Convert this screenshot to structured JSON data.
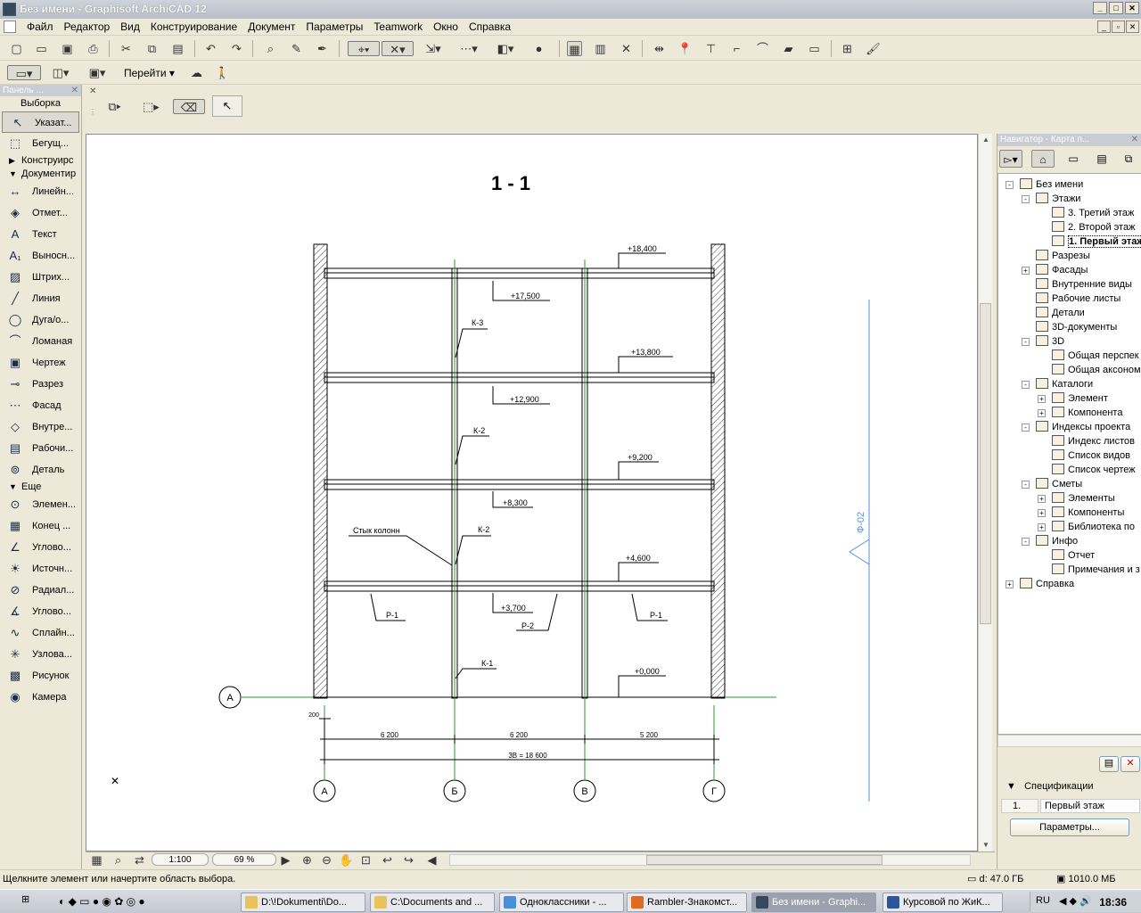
{
  "app": {
    "title": "Без имени - Graphisoft ArchiCAD 12"
  },
  "menu": [
    "Файл",
    "Редактор",
    "Вид",
    "Конструирование",
    "Документ",
    "Параметры",
    "Teamwork",
    "Окно",
    "Справка"
  ],
  "toolbar2": {
    "goto_label": "Перейти"
  },
  "left_panel": {
    "title": "Панель ...",
    "selection_label": "Выборка",
    "tools_top": [
      {
        "icon": "arrow-pointer-icon",
        "label": "Указат..."
      },
      {
        "icon": "marquee-icon",
        "label": "Бегущ..."
      }
    ],
    "group_construct": "Конструирс",
    "group_document": "Документир",
    "doc_tools": [
      {
        "icon": "linear-dimension-icon",
        "label": "Линейн..."
      },
      {
        "icon": "level-dimension-icon",
        "label": "Отмет..."
      },
      {
        "icon": "text-icon",
        "label": "Текст"
      },
      {
        "icon": "label-icon",
        "label": "Выносн..."
      },
      {
        "icon": "fill-icon",
        "label": "Штрих..."
      },
      {
        "icon": "line-icon",
        "label": "Линия"
      },
      {
        "icon": "arc-icon",
        "label": "Дуга/о..."
      },
      {
        "icon": "polyline-icon",
        "label": "Ломаная"
      },
      {
        "icon": "drawing-icon",
        "label": "Чертеж"
      },
      {
        "icon": "section-icon",
        "label": "Разрез"
      },
      {
        "icon": "elevation-icon",
        "label": "Фасад"
      },
      {
        "icon": "interior-elevation-icon",
        "label": "Внутре..."
      },
      {
        "icon": "worksheet-icon",
        "label": "Рабочи..."
      },
      {
        "icon": "detail-icon",
        "label": "Деталь"
      }
    ],
    "group_more": "Еще",
    "more_tools": [
      {
        "icon": "spot-icon",
        "label": "Элемен..."
      },
      {
        "icon": "object-icon",
        "label": "Конец ..."
      },
      {
        "icon": "angle-icon",
        "label": "Углово..."
      },
      {
        "icon": "lamp-icon",
        "label": "Источн..."
      },
      {
        "icon": "radial-dimension-icon",
        "label": "Радиал..."
      },
      {
        "icon": "angle-dimension-icon",
        "label": "Углово..."
      },
      {
        "icon": "spline-icon",
        "label": "Сплайн..."
      },
      {
        "icon": "hotspot-icon",
        "label": "Узлова..."
      },
      {
        "icon": "picture-icon",
        "label": "Рисунок"
      },
      {
        "icon": "camera-icon",
        "label": "Камера"
      }
    ]
  },
  "drawing": {
    "section_title": "1 - 1",
    "levels": [
      "+18,400",
      "+17,500",
      "+13,800",
      "+12,900",
      "+9,200",
      "+8,300",
      "+4,600",
      "+3,700",
      "+0,000"
    ],
    "column_labels": [
      "К-3",
      "К-2",
      "К-2",
      "К-1"
    ],
    "joint_label": "Стык колонн",
    "beam_labels": [
      "Р-1",
      "Р-2",
      "Р-1"
    ],
    "axes": [
      "А",
      "Б",
      "В",
      "Г"
    ],
    "left_axis": "А",
    "dims": [
      "6 200",
      "6 200",
      "5 200"
    ],
    "total_dim": "3В = 18 600",
    "offset_dim": "200",
    "facade_label": "Ф-02"
  },
  "bottom_bar": {
    "scale": "1:100",
    "zoom": "69 %"
  },
  "status": {
    "message": "Щелкните элемент или начертите область выбора.",
    "disk": "d: 47.0 ГБ",
    "memory": "1010.0 МБ"
  },
  "navigator": {
    "title": "Навигатор - Карта п...",
    "tree": [
      {
        "level": 0,
        "label": "Без имени",
        "exp": "-"
      },
      {
        "level": 1,
        "label": "Этажи",
        "exp": "-"
      },
      {
        "level": 2,
        "label": "3. Третий этаж"
      },
      {
        "level": 2,
        "label": "2. Второй этаж"
      },
      {
        "level": 2,
        "label": "1. Первый этаж",
        "bold": true
      },
      {
        "level": 1,
        "label": "Разрезы"
      },
      {
        "level": 1,
        "label": "Фасады",
        "exp": "+"
      },
      {
        "level": 1,
        "label": "Внутренние виды"
      },
      {
        "level": 1,
        "label": "Рабочие листы"
      },
      {
        "level": 1,
        "label": "Детали"
      },
      {
        "level": 1,
        "label": "3D-документы"
      },
      {
        "level": 1,
        "label": "3D",
        "exp": "-"
      },
      {
        "level": 2,
        "label": "Общая перспек"
      },
      {
        "level": 2,
        "label": "Общая аксоном"
      },
      {
        "level": 1,
        "label": "Каталоги",
        "exp": "-"
      },
      {
        "level": 2,
        "label": "Элемент",
        "exp": "+"
      },
      {
        "level": 2,
        "label": "Компонента",
        "exp": "+"
      },
      {
        "level": 1,
        "label": "Индексы проекта",
        "exp": "-"
      },
      {
        "level": 2,
        "label": "Индекс листов"
      },
      {
        "level": 2,
        "label": "Список видов"
      },
      {
        "level": 2,
        "label": "Список чертеж"
      },
      {
        "level": 1,
        "label": "Сметы",
        "exp": "-"
      },
      {
        "level": 2,
        "label": "Элементы",
        "exp": "+"
      },
      {
        "level": 2,
        "label": "Компоненты",
        "exp": "+"
      },
      {
        "level": 2,
        "label": "Библиотека по",
        "exp": "+"
      },
      {
        "level": 1,
        "label": "Инфо",
        "exp": "-"
      },
      {
        "level": 2,
        "label": "Отчет"
      },
      {
        "level": 2,
        "label": "Примечания и з"
      },
      {
        "level": 0,
        "label": "Справка",
        "exp": "+"
      }
    ],
    "spec_label": "Спецификации",
    "spec_num": "1.",
    "spec_value": "Первый этаж",
    "params_button": "Параметры..."
  },
  "taskbar": {
    "items": [
      {
        "label": "D:\\!Dokumenti\\Do...",
        "color": "#e8c25a"
      },
      {
        "label": "C:\\Documents and ...",
        "color": "#e8c25a"
      },
      {
        "label": "Одноклассники - ...",
        "color": "#4a8fdc"
      },
      {
        "label": "Rambler-Знакомст...",
        "color": "#e06a1f"
      },
      {
        "label": "Без имени - Graphi...",
        "color": "#34495e",
        "active": true
      },
      {
        "label": "Курсовой по ЖиК...",
        "color": "#2b579a"
      }
    ],
    "lang": "RU",
    "time": "18:36"
  }
}
